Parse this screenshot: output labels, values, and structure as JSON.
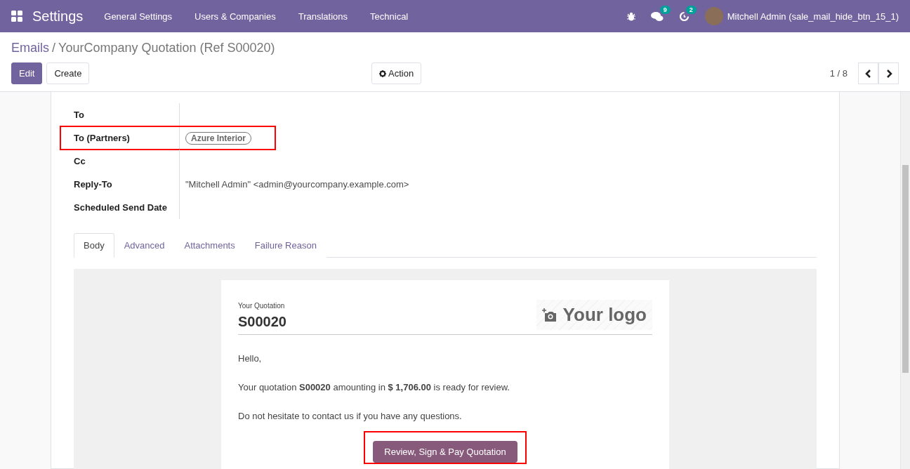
{
  "navbar": {
    "app_title": "Settings",
    "menu": [
      "General Settings",
      "Users & Companies",
      "Translations",
      "Technical"
    ],
    "messages_count": "9",
    "activities_count": "2",
    "user": "Mitchell Admin (sale_mail_hide_btn_15_1)"
  },
  "breadcrumb": {
    "parent": "Emails",
    "separator": "/",
    "current": "YourCompany Quotation (Ref S00020)"
  },
  "buttons": {
    "edit": "Edit",
    "create": "Create",
    "action": "Action"
  },
  "pager": "1 / 8",
  "fields": [
    {
      "label": "To",
      "kind": "empty",
      "highlighted": false
    },
    {
      "label": "To (Partners)",
      "kind": "tag",
      "value": "Azure Interior",
      "highlighted": true
    },
    {
      "label": "Cc",
      "kind": "empty",
      "highlighted": false
    },
    {
      "label": "Reply-To",
      "kind": "text",
      "value": "\"Mitchell Admin\" <admin@yourcompany.example.com>",
      "highlighted": false
    },
    {
      "label": "Scheduled Send Date",
      "kind": "empty",
      "highlighted": false
    }
  ],
  "tabs": [
    {
      "label": "Body",
      "selected": true
    },
    {
      "label": "Advanced",
      "selected": false
    },
    {
      "label": "Attachments",
      "selected": false
    },
    {
      "label": "Failure Reason",
      "selected": false
    }
  ],
  "email": {
    "caption": "Your Quotation",
    "number": "S00020",
    "logo": "Your logo",
    "paragraphs": [
      "Hello,",
      "Your quotation **S00020** amounting in **$ 1,706.00** is ready for review.",
      "Do not hesitate to contact us if you have any questions."
    ],
    "cta": "Review, Sign & Pay Quotation",
    "cta_highlighted": true
  }
}
